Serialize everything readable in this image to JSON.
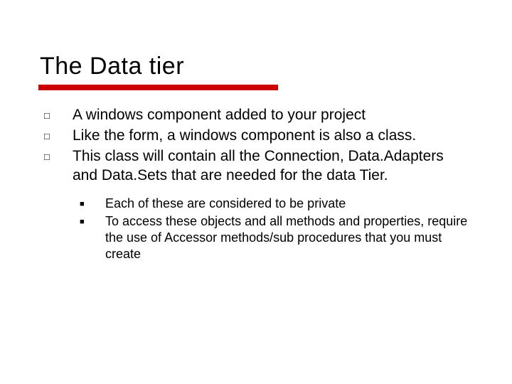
{
  "title": "The Data tier",
  "bullets": [
    "A windows component added to your project",
    "Like the form, a windows component is also a class.",
    "This class will contain all the Connection, Data.Adapters and Data.Sets that are needed for the data Tier."
  ],
  "subbullets": [
    "Each of these are considered to be private",
    "To access these objects and all methods and properties, require the use of Accessor methods/sub procedures that you must create"
  ],
  "markers": {
    "box": "□",
    "square": "■"
  }
}
